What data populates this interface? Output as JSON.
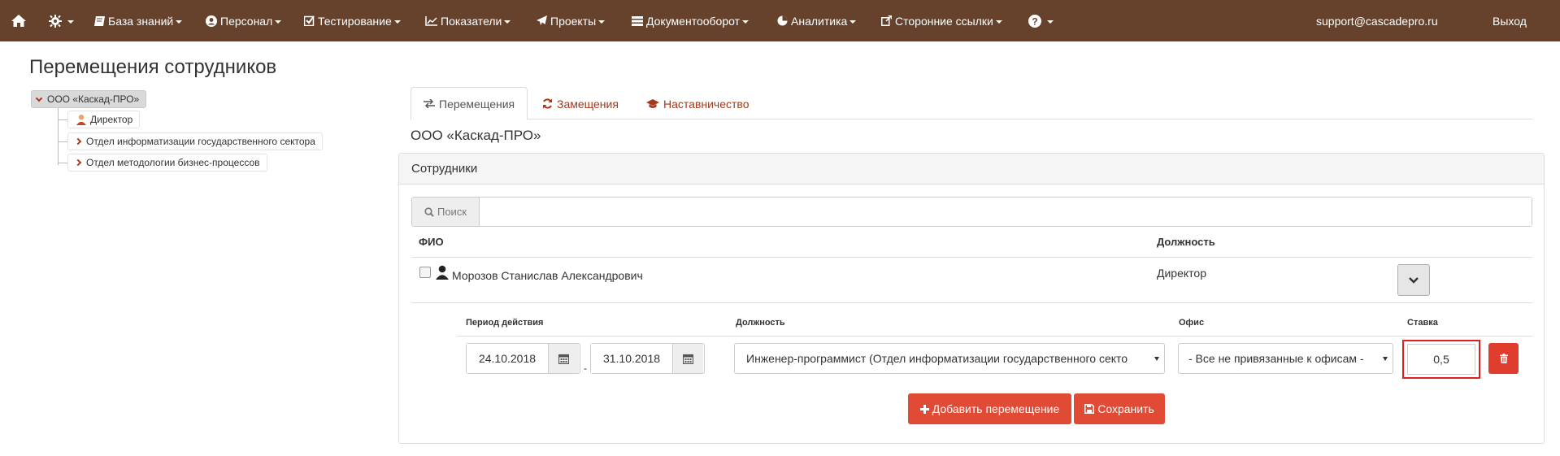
{
  "navbar": {
    "items": [
      {
        "label": "База знаний"
      },
      {
        "label": "Персонал"
      },
      {
        "label": "Тестирование"
      },
      {
        "label": "Показатели"
      },
      {
        "label": "Проекты"
      },
      {
        "label": "Документооборот"
      },
      {
        "label": "Аналитика"
      },
      {
        "label": "Сторонние ссылки"
      }
    ],
    "user_email": "support@cascadepro.ru",
    "logout_label": "Выход"
  },
  "page_title": "Перемещения сотрудников",
  "tree": {
    "root": "ООО «Каскад-ПРО»",
    "children": [
      "Директор",
      "Отдел информатизации государственного сектора",
      "Отдел методологии бизнес-процессов"
    ]
  },
  "tabs": [
    "Перемещения",
    "Замещения",
    "Наставничество"
  ],
  "org_title": "ООО «Каскад-ПРО»",
  "panel": {
    "heading": "Сотрудники",
    "search_label": "Поиск",
    "search_value": "",
    "columns": {
      "fio": "ФИО",
      "position": "Должность"
    },
    "employee": {
      "name": "Морозов Станислав Александрович",
      "position": "Директор"
    }
  },
  "movement": {
    "headers": {
      "period": "Период действия",
      "position": "Должность",
      "office": "Офис",
      "rate": "Ставка"
    },
    "date_from": "24.10.2018",
    "date_to": "31.10.2018",
    "date_separator": "-",
    "position_value": "Инженер-программист (Отдел информатизации государственного секто",
    "office_value": "- Все не привязанные к офисам -",
    "rate_value": "0,5"
  },
  "buttons": {
    "add": "Добавить перемещение",
    "save": "Сохранить"
  },
  "colors": {
    "navbar_bg": "#66422d",
    "accent_link": "#a33a1c",
    "danger": "#e14a34",
    "highlight_border": "#e02020"
  }
}
